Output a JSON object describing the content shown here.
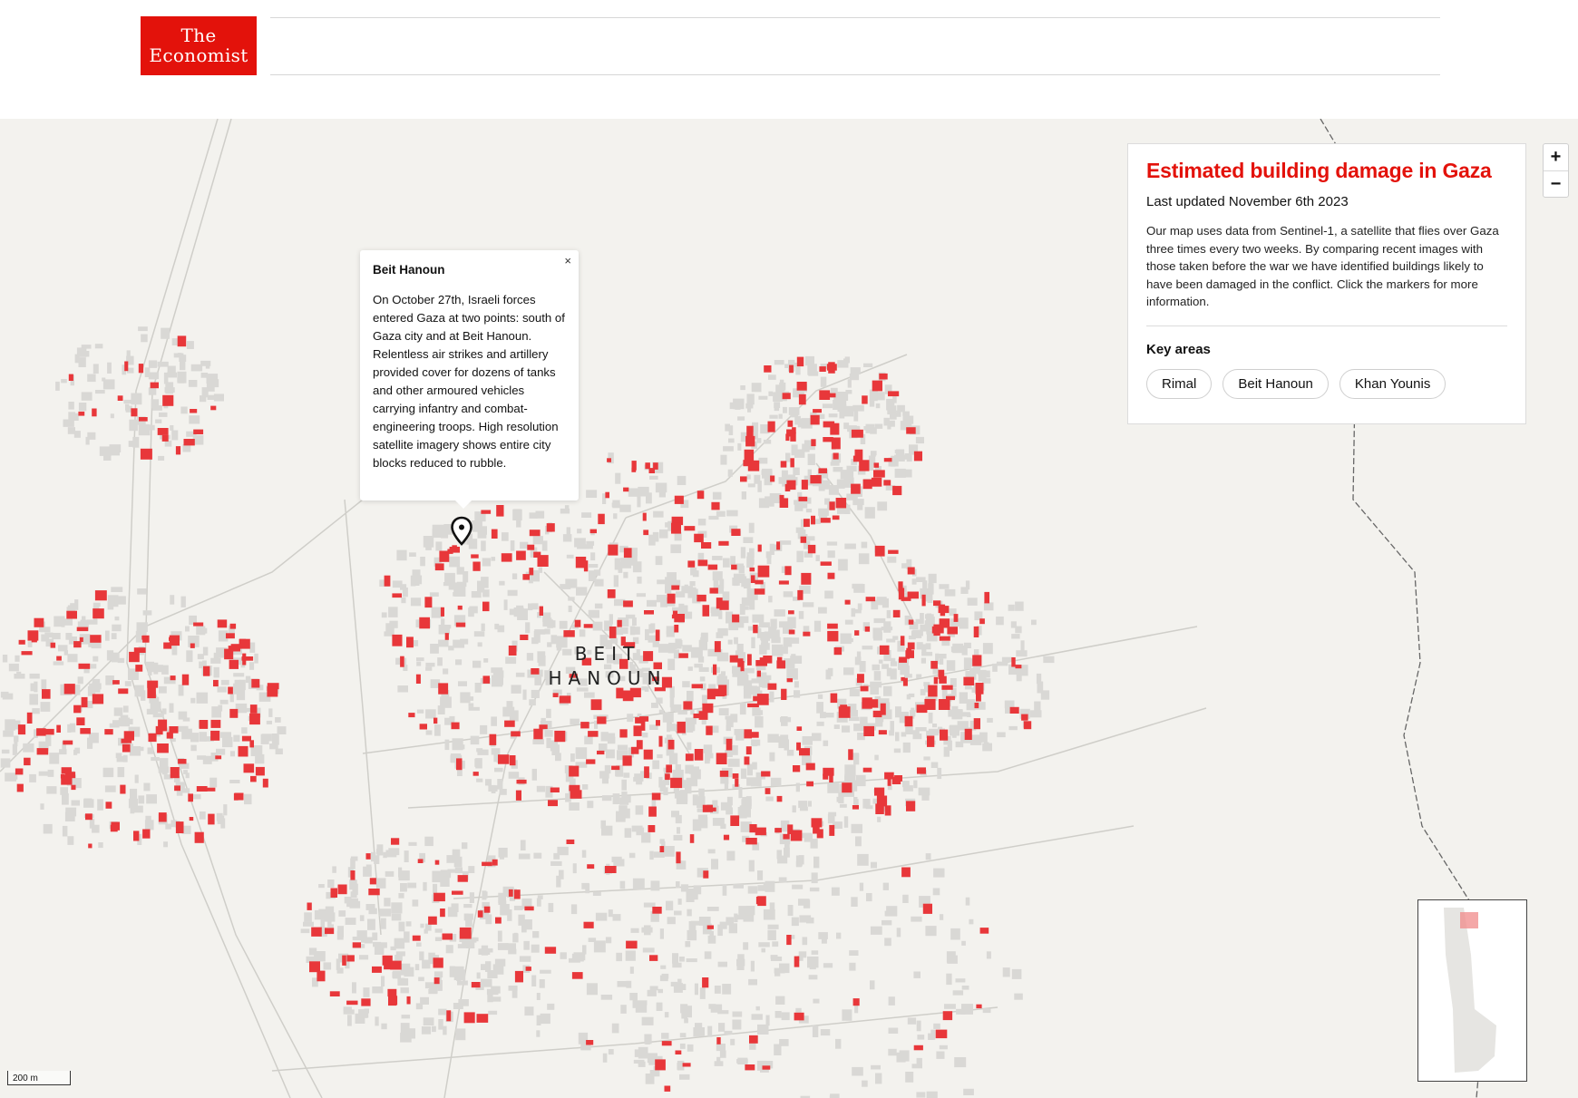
{
  "header": {
    "logo_line1": "The",
    "logo_line2": "Economist"
  },
  "map": {
    "place_label_line1": "BEIT",
    "place_label_line2": "HANOUN",
    "scale_label": "200 m",
    "colors": {
      "background": "#f3f2ee",
      "building": "#d9d8d5",
      "damaged": "#e8373a",
      "roads": "#c9c8c4",
      "border": "#666666"
    }
  },
  "popup": {
    "title": "Beit Hanoun",
    "close_label": "×",
    "body": "On October 27th, Israeli forces entered Gaza at two points: south of Gaza city and at Beit Hanoun. Relentless air strikes and artillery provided cover for dozens of tanks and other armoured vehicles carrying infantry and combat-engineering troops. High resolution satellite imagery shows entire city blocks reduced to rubble."
  },
  "info": {
    "title": "Estimated building damage in Gaza",
    "updated": "Last updated November 6th 2023",
    "description": "Our map uses data from Sentinel-1, a satellite that flies over Gaza three times every two weeks. By comparing recent images with those taken before the war we have identified buildings likely to have been damaged in the conflict. Click the markers for more information.",
    "key_areas_label": "Key areas",
    "key_areas": [
      "Rimal",
      "Beit Hanoun",
      "Khan Younis"
    ]
  },
  "zoom": {
    "in_label": "+",
    "out_label": "−"
  },
  "icons": {
    "marker": "map-pin-icon",
    "close": "close-icon"
  }
}
